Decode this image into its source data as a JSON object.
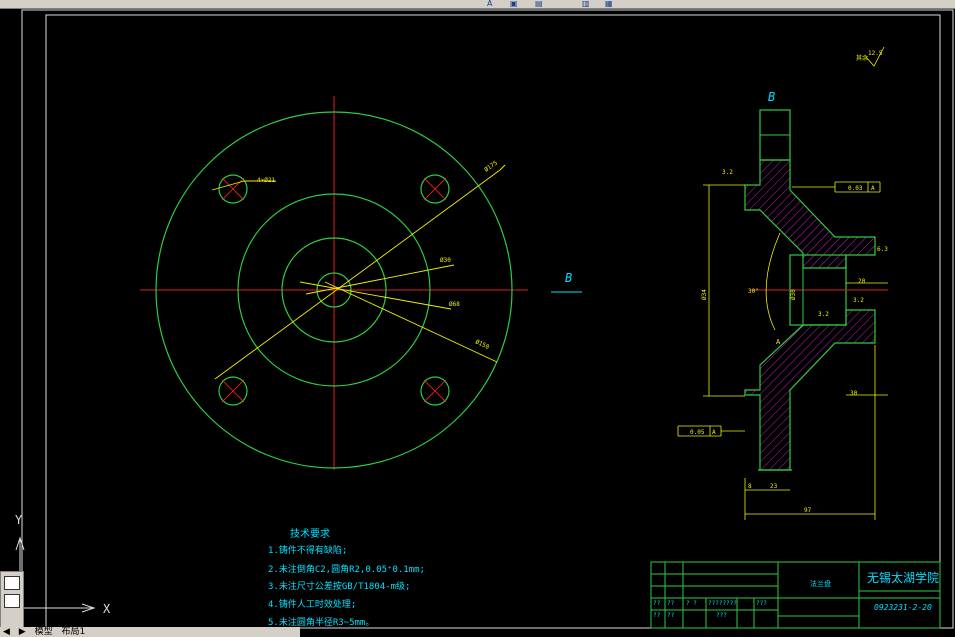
{
  "toolbar": {
    "items": [
      "A",
      "▣",
      "▤",
      "▥",
      "▦"
    ]
  },
  "tabs": {
    "model": "模型",
    "layout": "布局1"
  },
  "view": {
    "section_label": "B",
    "arrow_label": "B",
    "roughness_note": "12.5",
    "roughness_prefix": "其余"
  },
  "dims": {
    "d175": "Ø175",
    "d30": "Ø30",
    "d4x21": "4×Ø21",
    "d_small": "Ø68",
    "d_big": "Ø150",
    "dia_left": "Ø34",
    "dia_center": "Ø30",
    "width_20": "20",
    "width_30": "30",
    "width_8": "8",
    "width_23": "23",
    "width_97": "97",
    "angle_30": "30°",
    "rough_32a": "3.2",
    "rough_32b": "3.2",
    "rough_32c": "3.2",
    "rough_63": "6.3",
    "tol1": "0.03",
    "tol1_ref": "A",
    "tol2": "0.05",
    "tol2_ref": "A",
    "datum": "A"
  },
  "notes": {
    "title": "技术要求",
    "lines": [
      "1.铸件不得有缺陷;",
      "2.未注倒角C2,圆角R2,0.05⁺0.1mm;",
      "3.未注尺寸公差按GB/T1804-m级;",
      "4.铸件人工时效处理;",
      "5.未注圆角半径R3~5mm。"
    ]
  },
  "titleblock": {
    "part_name": "法兰盘",
    "school": "无锡太湖学院",
    "drawing_no": "0923231-2-20",
    "cells": [
      "??",
      "??",
      "? ?",
      "????????",
      "???",
      "??",
      "??",
      "???"
    ]
  },
  "ucs": {
    "y": "Y",
    "x": "X"
  }
}
